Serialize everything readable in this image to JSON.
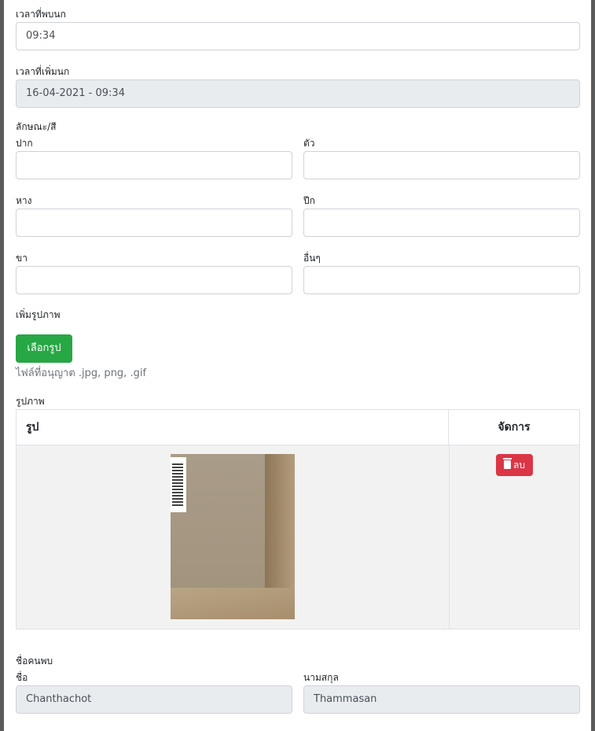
{
  "form": {
    "found_time": {
      "label": "เวลาที่พบนก",
      "value": "09:34"
    },
    "added_time": {
      "label": "เวลาที่เพิ่มนก",
      "value": "16-04-2021 - 09:34"
    },
    "traits": {
      "section_label": "ลักษณะ/สี",
      "beak": {
        "label": "ปาก",
        "value": ""
      },
      "body": {
        "label": "ตัว",
        "value": ""
      },
      "tail": {
        "label": "หาง",
        "value": ""
      },
      "wing": {
        "label": "ปีก",
        "value": ""
      },
      "leg": {
        "label": "ขา",
        "value": ""
      },
      "other": {
        "label": "อื่นๆ",
        "value": ""
      }
    },
    "upload": {
      "label": "เพิ่มรูปภาพ",
      "button_label": "เลือกรูป",
      "hint": "ไฟล์ที่อนุญาต .jpg, png, .gif"
    },
    "images": {
      "label": "รูปภาพ",
      "columns": [
        "รูป",
        "จัดการ"
      ],
      "delete_label": "ลบ"
    },
    "finder": {
      "section_label": "ชื่อคนพบ",
      "first_name": {
        "label": "ชื่อ",
        "value": "Chanthachot"
      },
      "last_name": {
        "label": "นามสกุล",
        "value": "Thammasan"
      }
    }
  },
  "colors": {
    "choose_button": "#28a745",
    "delete_button": "#dc3545",
    "readonly_bg": "#e9ecef",
    "table_row_bg": "#f2f2f2"
  },
  "icons": {
    "delete": "trash-icon"
  }
}
